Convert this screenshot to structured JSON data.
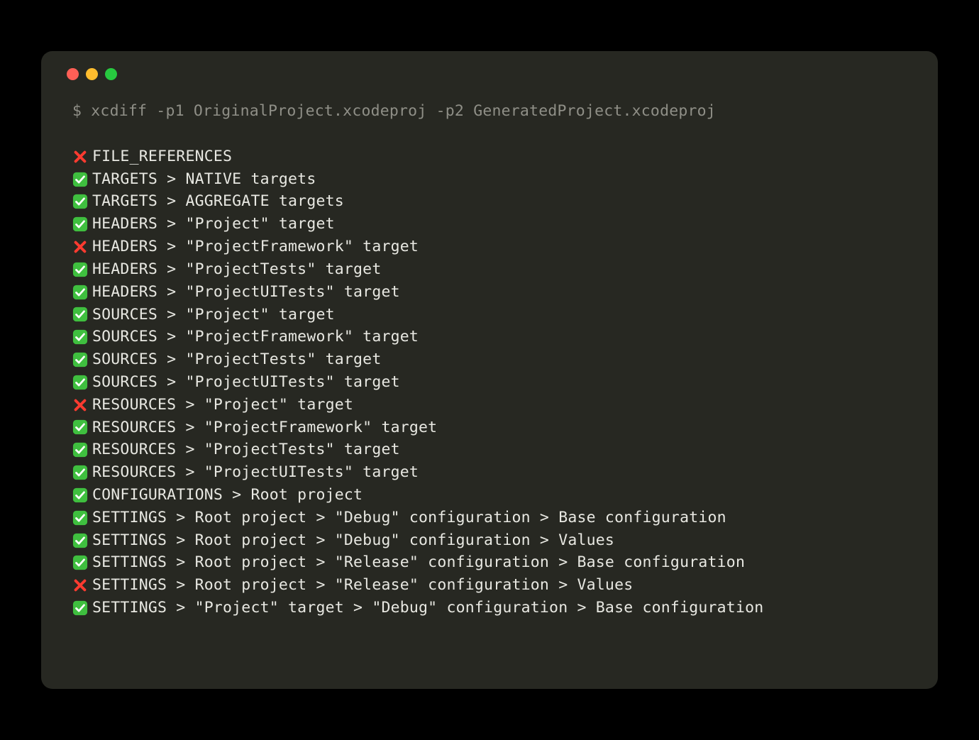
{
  "command": "$ xcdiff -p1 OriginalProject.xcodeproj -p2 GeneratedProject.xcodeproj",
  "lines": [
    {
      "status": "fail",
      "text": "FILE_REFERENCES"
    },
    {
      "status": "pass",
      "text": "TARGETS > NATIVE targets"
    },
    {
      "status": "pass",
      "text": "TARGETS > AGGREGATE targets"
    },
    {
      "status": "pass",
      "text": "HEADERS > \"Project\" target"
    },
    {
      "status": "fail",
      "text": "HEADERS > \"ProjectFramework\" target"
    },
    {
      "status": "pass",
      "text": "HEADERS > \"ProjectTests\" target"
    },
    {
      "status": "pass",
      "text": "HEADERS > \"ProjectUITests\" target"
    },
    {
      "status": "pass",
      "text": "SOURCES > \"Project\" target"
    },
    {
      "status": "pass",
      "text": "SOURCES > \"ProjectFramework\" target"
    },
    {
      "status": "pass",
      "text": "SOURCES > \"ProjectTests\" target"
    },
    {
      "status": "pass",
      "text": "SOURCES > \"ProjectUITests\" target"
    },
    {
      "status": "fail",
      "text": "RESOURCES > \"Project\" target"
    },
    {
      "status": "pass",
      "text": "RESOURCES > \"ProjectFramework\" target"
    },
    {
      "status": "pass",
      "text": "RESOURCES > \"ProjectTests\" target"
    },
    {
      "status": "pass",
      "text": "RESOURCES > \"ProjectUITests\" target"
    },
    {
      "status": "pass",
      "text": "CONFIGURATIONS > Root project"
    },
    {
      "status": "pass",
      "text": "SETTINGS > Root project > \"Debug\" configuration > Base configuration"
    },
    {
      "status": "pass",
      "text": "SETTINGS > Root project > \"Debug\" configuration > Values"
    },
    {
      "status": "pass",
      "text": "SETTINGS > Root project > \"Release\" configuration > Base configuration"
    },
    {
      "status": "fail",
      "text": "SETTINGS > Root project > \"Release\" configuration > Values"
    },
    {
      "status": "pass",
      "text": "SETTINGS > \"Project\" target > \"Debug\" configuration > Base configuration"
    }
  ]
}
